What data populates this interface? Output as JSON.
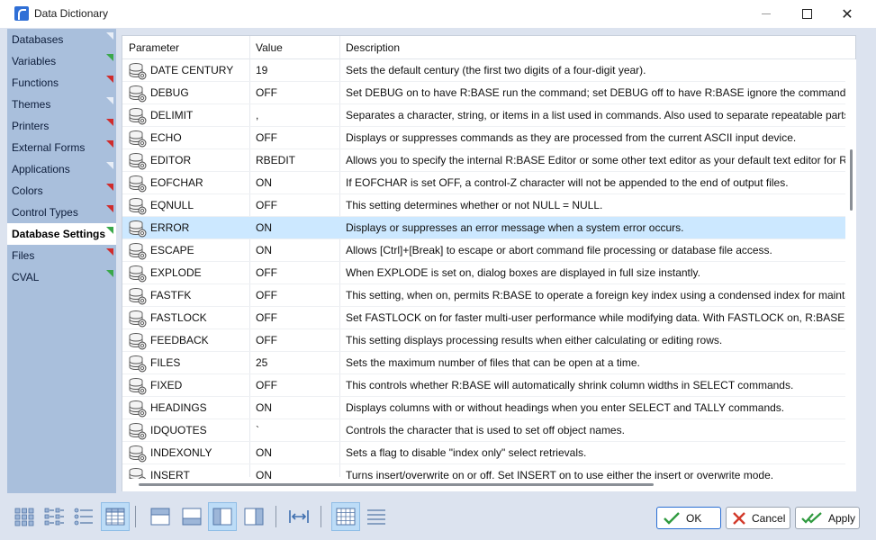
{
  "window": {
    "title": "Data Dictionary",
    "icon": "app-icon"
  },
  "sidebar": {
    "items": [
      {
        "label": "Databases",
        "marker": "#e8eef7"
      },
      {
        "label": "Variables",
        "marker": "#3aa84a"
      },
      {
        "label": "Functions",
        "marker": "#d02c2c"
      },
      {
        "label": "Themes",
        "marker": "#e8eef7"
      },
      {
        "label": "Printers",
        "marker": "#d02c2c"
      },
      {
        "label": "External Forms",
        "marker": "#d02c2c"
      },
      {
        "label": "Applications",
        "marker": "#e8eef7"
      },
      {
        "label": "Colors",
        "marker": "#d02c2c"
      },
      {
        "label": "Control Types",
        "marker": "#d02c2c"
      },
      {
        "label": "Database Settings",
        "marker": "#3aa84a"
      },
      {
        "label": "Files",
        "marker": "#d02c2c"
      },
      {
        "label": "CVAL",
        "marker": "#3aa84a"
      }
    ],
    "active": "Database Settings"
  },
  "grid": {
    "columns": [
      "Parameter",
      "Value",
      "Description"
    ],
    "selected_row": "ERROR",
    "rows": [
      {
        "param": "DATE CENTURY",
        "value": "19",
        "desc": "Sets the default century (the first two digits of a four-digit year)."
      },
      {
        "param": "DEBUG",
        "value": "OFF",
        "desc": "Set DEBUG on to have R:BASE run the command; set DEBUG off to have R:BASE ignore the command."
      },
      {
        "param": "DELIMIT",
        "value": ",",
        "desc": "Separates a character, string, or items in a list used in commands. Also used to separate repeatable parts o"
      },
      {
        "param": "ECHO",
        "value": "OFF",
        "desc": "Displays or suppresses commands as they are processed from the current ASCII input device."
      },
      {
        "param": "EDITOR",
        "value": "RBEDIT",
        "desc": "Allows you to specify the internal R:BASE Editor or some other text editor as your default text editor for R:E"
      },
      {
        "param": "EOFCHAR",
        "value": "ON",
        "desc": "If EOFCHAR is set OFF, a control-Z character will not be appended to the end of output files."
      },
      {
        "param": "EQNULL",
        "value": "OFF",
        "desc": "This setting determines whether or not NULL = NULL."
      },
      {
        "param": "ERROR",
        "value": "ON",
        "desc": "Displays or suppresses an error message when a system error occurs."
      },
      {
        "param": "ESCAPE",
        "value": "ON",
        "desc": "Allows [Ctrl]+[Break] to escape or abort command file processing or database file access."
      },
      {
        "param": "EXPLODE",
        "value": "OFF",
        "desc": "When EXPLODE is set on, dialog boxes are displayed in full size instantly."
      },
      {
        "param": "FASTFK",
        "value": "OFF",
        "desc": "This setting, when on, permits R:BASE to operate a foreign key index using a condensed index for maintai"
      },
      {
        "param": "FASTLOCK",
        "value": "OFF",
        "desc": "Set FASTLOCK on for faster multi-user performance while modifying data. With FASTLOCK on, R:BASE doe"
      },
      {
        "param": "FEEDBACK",
        "value": "OFF",
        "desc": "This setting displays processing results when either calculating or editing rows."
      },
      {
        "param": "FILES",
        "value": "25",
        "desc": "Sets the maximum number of files that can be open at a time."
      },
      {
        "param": "FIXED",
        "value": "OFF",
        "desc": "This controls whether R:BASE will automatically shrink column widths in SELECT commands."
      },
      {
        "param": "HEADINGS",
        "value": "ON",
        "desc": "Displays columns with or without headings when you enter SELECT and TALLY commands."
      },
      {
        "param": "IDQUOTES",
        "value": "`",
        "desc": "Controls the character that is used to set off object names."
      },
      {
        "param": "INDEXONLY",
        "value": "ON",
        "desc": "Sets a flag to disable \"index only\" select retrievals."
      },
      {
        "param": "INSERT",
        "value": "ON",
        "desc": "Turns insert/overwrite on or off. Set INSERT on to use either the insert or overwrite mode."
      }
    ]
  },
  "toolbar": {
    "buttons": [
      {
        "name": "large-icons-view-icon",
        "on": false
      },
      {
        "name": "small-icons-view-icon",
        "on": false
      },
      {
        "name": "list-view-icon",
        "on": false
      },
      {
        "name": "details-view-icon",
        "on": true
      },
      {
        "name": "layout-top-icon",
        "on": false
      },
      {
        "name": "layout-bottom-icon",
        "on": false
      },
      {
        "name": "layout-left-icon",
        "on": true
      },
      {
        "name": "layout-right-icon",
        "on": false
      },
      {
        "name": "fit-width-icon",
        "on": false
      },
      {
        "name": "grid-lines-icon",
        "on": true
      },
      {
        "name": "row-lines-icon",
        "on": false
      }
    ],
    "ok_label": "OK",
    "cancel_label": "Cancel",
    "apply_label": "Apply"
  },
  "colors": {
    "accent": "#2a6fd3",
    "selection": "#cce8ff",
    "sidebar_bg": "#a9bfdc",
    "ok_check": "#2f9a3f",
    "cancel_x": "#d23a2a"
  }
}
